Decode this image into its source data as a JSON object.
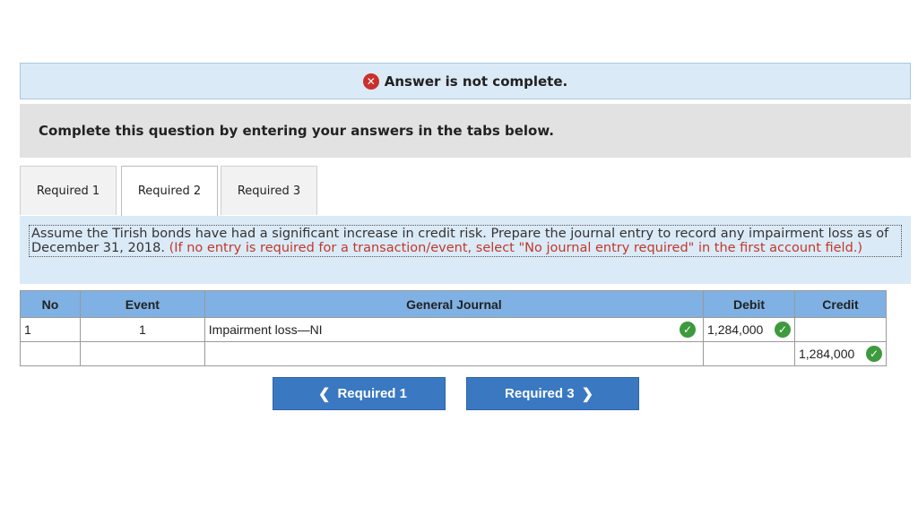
{
  "banner": {
    "icon": "x-circle-icon",
    "text": "Answer is not complete."
  },
  "instruction": "Complete this question by entering your answers in the tabs below.",
  "tabs": [
    {
      "label": "Required 1",
      "active": false
    },
    {
      "label": "Required 2",
      "active": true
    },
    {
      "label": "Required 3",
      "active": false
    }
  ],
  "question": {
    "text": "Assume the Tirish bonds have had a significant increase in credit risk. Prepare the journal entry to record any impairment loss as of December 31, 2018. ",
    "hint": "(If no entry is required for a transaction/event, select \"No journal entry required\" in the first account field.)"
  },
  "table": {
    "headers": {
      "no": "No",
      "event": "Event",
      "journal": "General Journal",
      "debit": "Debit",
      "credit": "Credit"
    },
    "rows": [
      {
        "no": "1",
        "event": "1",
        "account": "Impairment loss—NI",
        "debit": "1,284,000",
        "credit": ""
      },
      {
        "no": "",
        "event": "",
        "account": "",
        "debit": "",
        "credit": "1,284,000"
      }
    ]
  },
  "nav": {
    "prev_label": "Required 1",
    "next_label": "Required 3"
  },
  "colors": {
    "accent": "#3a78c2",
    "header": "#7fb1e4",
    "banner": "#dbeaf7",
    "error": "#c9302c",
    "check": "#3d9a3d"
  }
}
